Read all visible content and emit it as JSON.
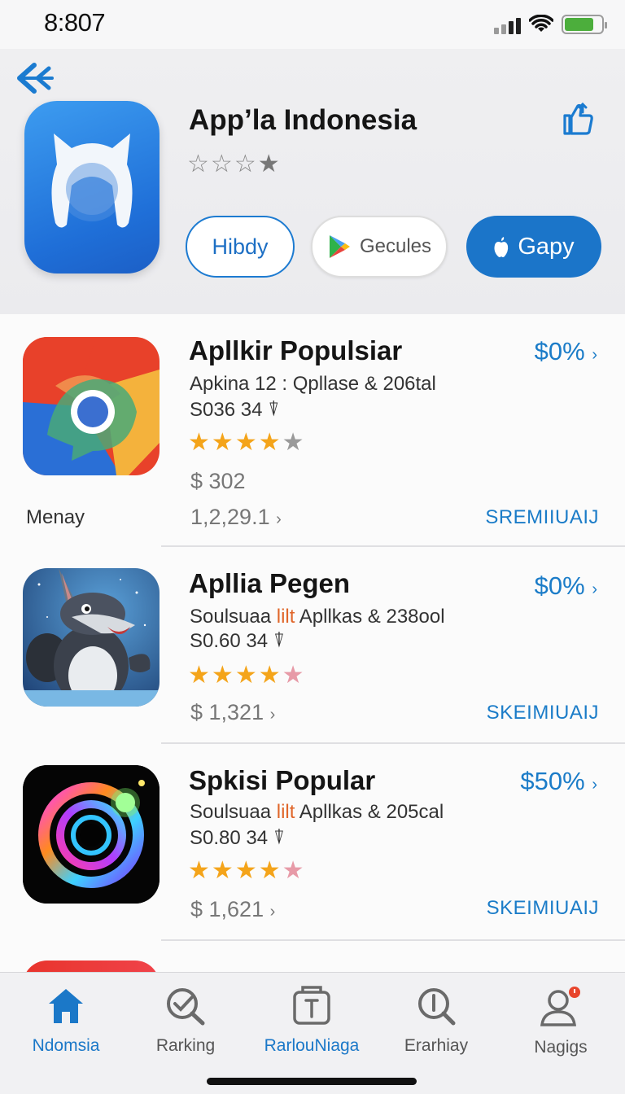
{
  "status_bar": {
    "time": "8:807"
  },
  "header": {
    "title": "App’la Indonesia",
    "rating": {
      "filled": 1,
      "total": 4
    },
    "buttons": [
      {
        "label": "Hibdy"
      },
      {
        "label": "Gecules",
        "icon": "play-store-icon"
      },
      {
        "label": "Gapy",
        "icon": "apple-icon"
      }
    ]
  },
  "list": {
    "items": [
      {
        "title": "Apllkir Populsiar",
        "subtitle_a": "Apkina  12 : Qpllase & 206tal",
        "size": "S036 34",
        "stars": {
          "filled": 4,
          "total": 5
        },
        "price": "$ 302",
        "extra": "1,2,29.1",
        "percent": "$0%",
        "action": "SREMIIUAIJ",
        "label": "Menay",
        "icon": "chrome-like-icon"
      },
      {
        "title": "Apllia Pegen",
        "subtitle_a": "Soulsuaa ",
        "subtitle_hl": "lilt",
        "subtitle_b": " Apllkas & 238ool",
        "size": "S0.60 34",
        "stars": {
          "filled": 4,
          "partial": 1,
          "total": 5
        },
        "price": "$ 1,321",
        "percent": "$0%",
        "action": "SKEIMIUAIJ",
        "icon": "cartoon-creature-icon"
      },
      {
        "title": "Spkisi Popular",
        "subtitle_a": "Soulsuaa ",
        "subtitle_hl": "lilt",
        "subtitle_b": " Apllkas & 205cal",
        "size": "S0.80 34",
        "stars": {
          "filled": 4,
          "partial": 1,
          "total": 5
        },
        "price": "$ 1,621",
        "percent": "$50%",
        "action": "SKEIMIUAIJ",
        "icon": "neon-rings-icon"
      }
    ]
  },
  "tabs": [
    {
      "label": "Ndomsia",
      "icon": "home-icon",
      "active": true
    },
    {
      "label": "Rarking",
      "icon": "search-check-icon"
    },
    {
      "label": "RarlouNiaga",
      "icon": "box-icon"
    },
    {
      "label": "Erarhiay",
      "icon": "search-icon"
    },
    {
      "label": "Nagigs",
      "icon": "profile-icon"
    }
  ],
  "colors": {
    "accent": "#1b75c9",
    "star": "#f4a41a"
  }
}
